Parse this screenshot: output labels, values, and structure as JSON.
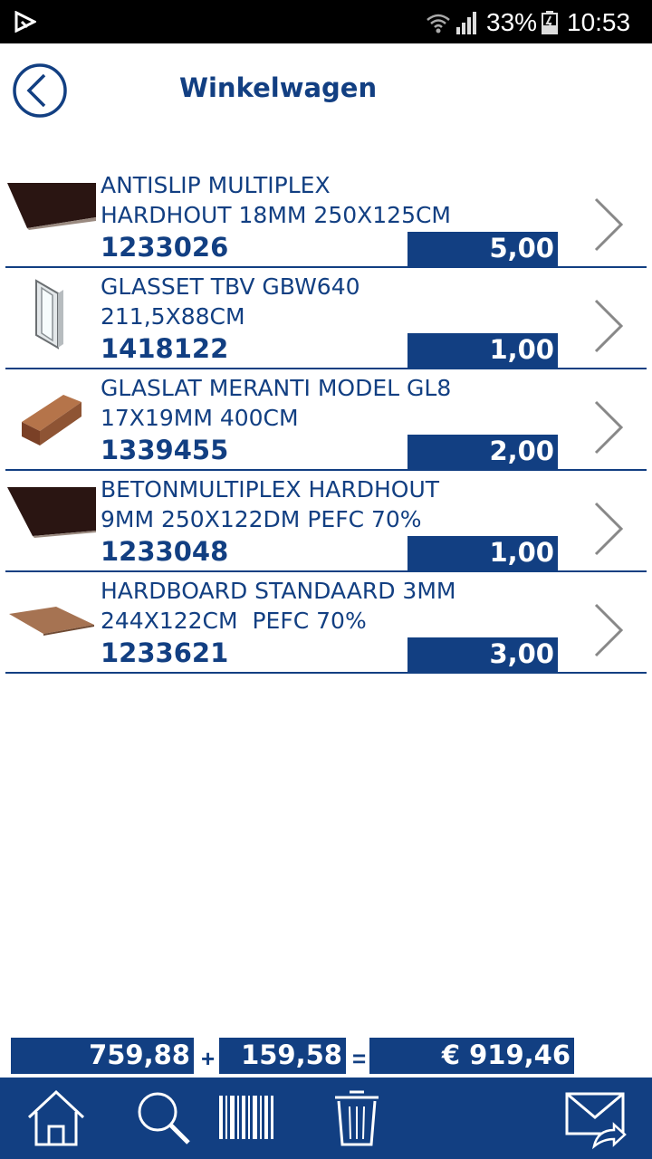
{
  "status_bar": {
    "battery_percent": "33%",
    "time": "10:53"
  },
  "header": {
    "title": "Winkelwagen",
    "back_icon": "back-arrow-icon"
  },
  "cart": {
    "items": [
      {
        "description": "ANTISLIP MULTIPLEX\nHARDHOUT 18MM 250X125CM",
        "code": "1233026",
        "quantity": "5,00",
        "thumbnail": "dark-board"
      },
      {
        "description": "GLASSET TBV GBW640\n211,5X88CM",
        "code": "1418122",
        "quantity": "1,00",
        "thumbnail": "glass-set"
      },
      {
        "description": "GLASLAT MERANTI MODEL GL8\n17X19MM 400CM",
        "code": "1339455",
        "quantity": "2,00",
        "thumbnail": "wood-slat"
      },
      {
        "description": "BETONMULTIPLEX HARDHOUT\n9MM 250X122DM PEFC 70%",
        "code": "1233048",
        "quantity": "1,00",
        "thumbnail": "dark-board"
      },
      {
        "description": "HARDBOARD STANDAARD 3MM\n244X122CM  PEFC 70%",
        "code": "1233621",
        "quantity": "3,00",
        "thumbnail": "hardboard"
      }
    ]
  },
  "totals": {
    "subtotal": "759,88",
    "plus": "+",
    "vat": "159,58",
    "equals": "=",
    "total": "€ 919,46"
  },
  "bottom_nav": {
    "items": [
      "home-icon",
      "search-icon",
      "barcode-icon",
      "trash-icon",
      "email-send-icon"
    ]
  },
  "colors": {
    "brand_blue": "#123f82",
    "background": "#ffffff"
  }
}
